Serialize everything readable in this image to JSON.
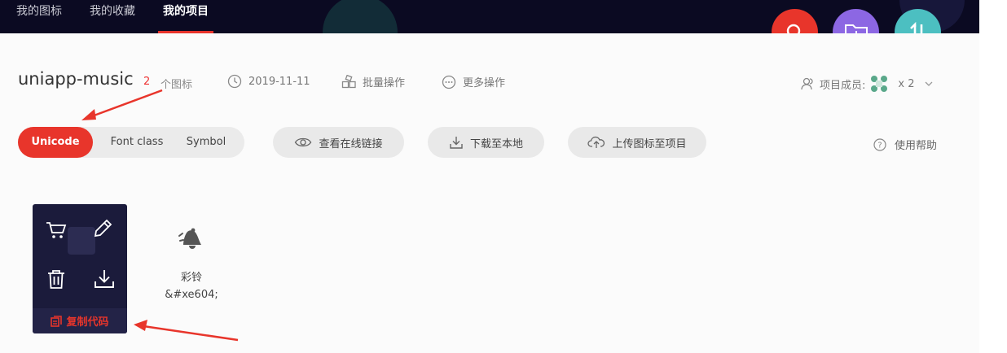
{
  "nav": {
    "items": [
      {
        "label": "我的图标"
      },
      {
        "label": "我的收藏"
      },
      {
        "label": "我的项目",
        "active": true
      }
    ]
  },
  "fab": [
    "search-icon",
    "add-folder-icon",
    "sort-icon"
  ],
  "project": {
    "name": "uniapp-music",
    "icon_count": "2",
    "icon_count_label": "个图标",
    "date": "2019-11-11",
    "batch_label": "批量操作",
    "more_label": "更多操作",
    "members_label": "项目成员:",
    "members_count": "x 2"
  },
  "toolbar": {
    "tabs": [
      {
        "label": "Unicode",
        "active": true
      },
      {
        "label": "Font class"
      },
      {
        "label": "Symbol"
      }
    ],
    "view_online": "查看在线链接",
    "download": "下载至本地",
    "upload": "上传图标至项目",
    "help": "使用帮助"
  },
  "icons": [
    {
      "name": "",
      "hover_actions": [
        "cart-icon",
        "edit-icon",
        "trash-icon",
        "download-icon"
      ],
      "copy_label": "复制代码"
    },
    {
      "name": "彩铃",
      "code": "&#xe604;"
    }
  ],
  "colors": {
    "accent": "#e8352b",
    "topbar": "#0b0a22",
    "fab_purple": "#8c67e3",
    "fab_teal": "#4cbfc1",
    "card": "#1b1b3b"
  }
}
